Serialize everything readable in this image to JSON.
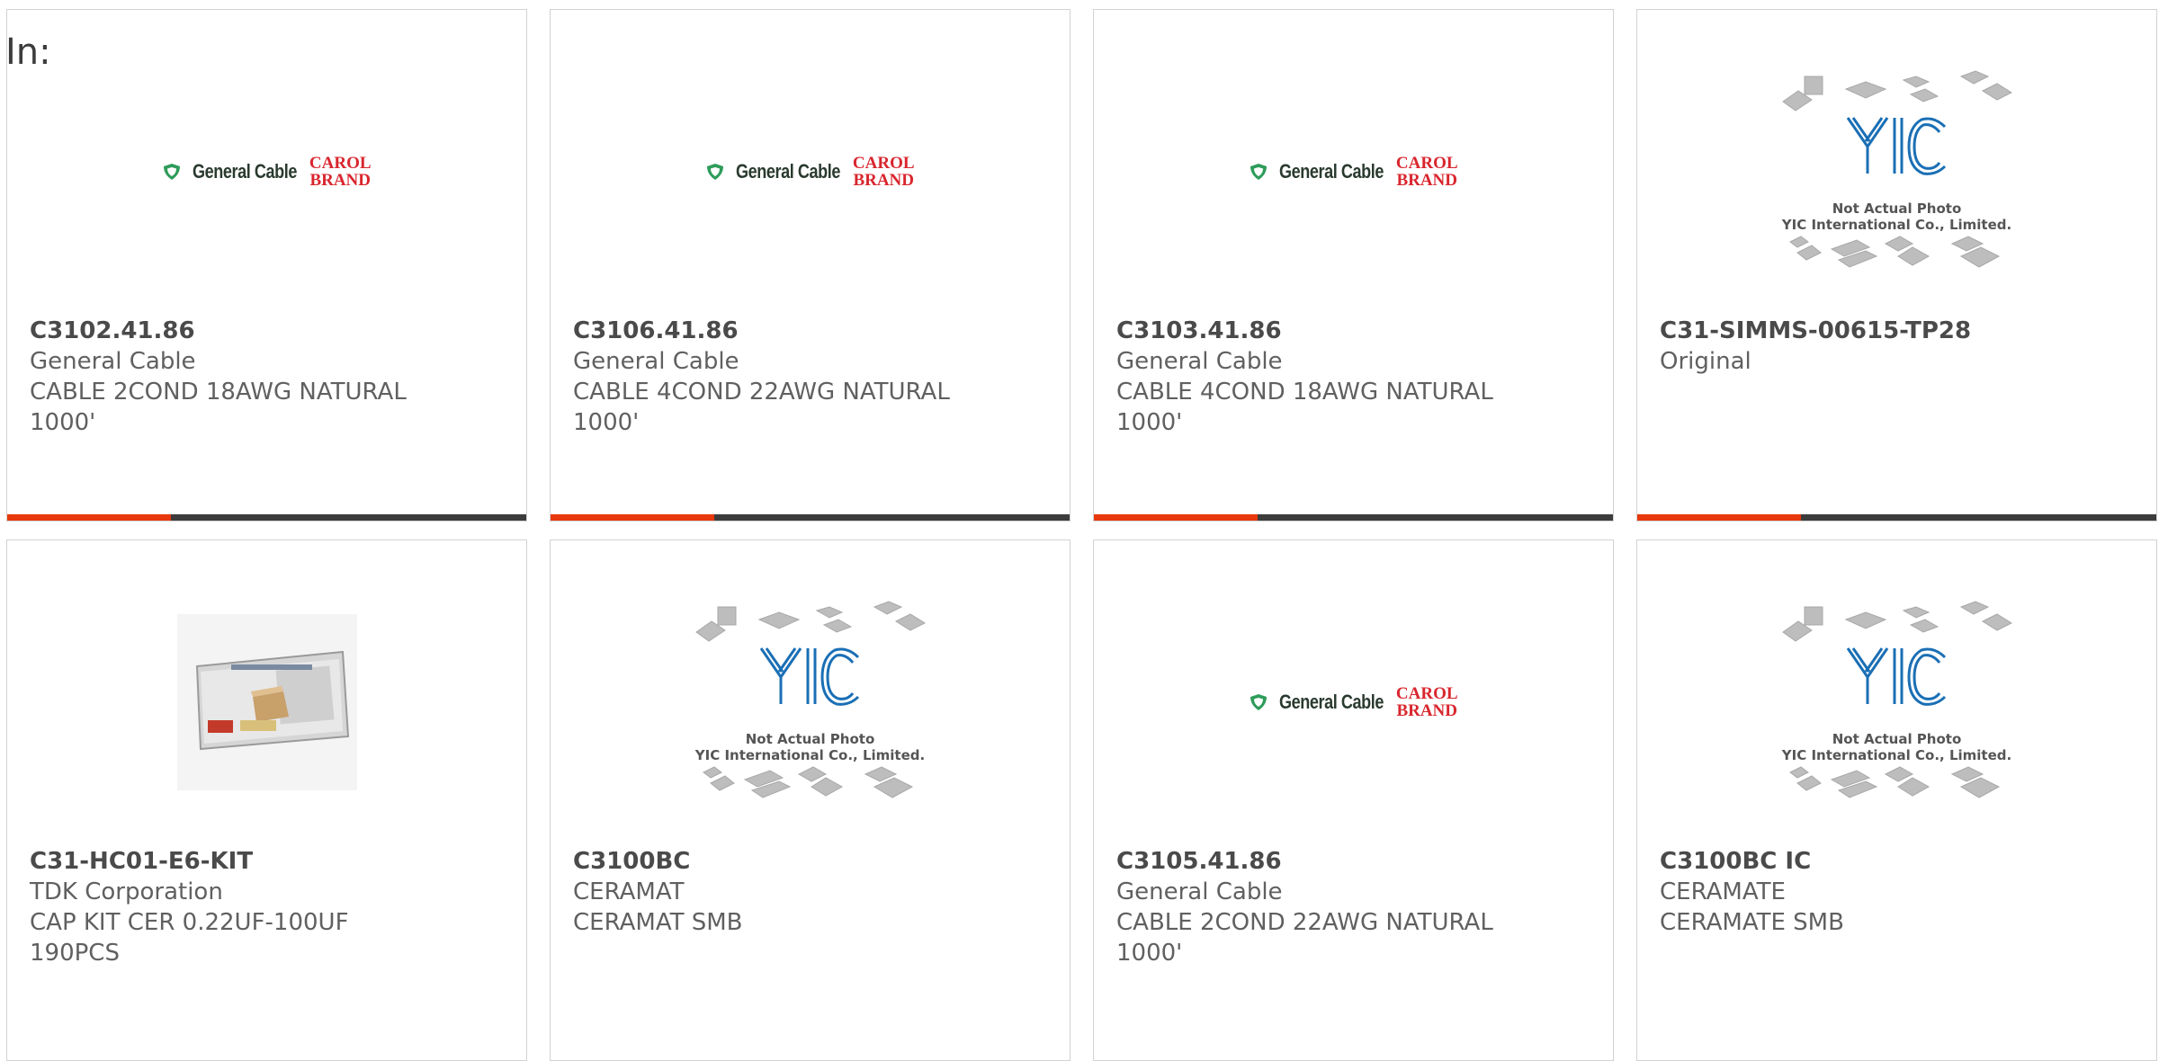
{
  "header": {
    "label": "In:"
  },
  "logos": {
    "general_cable": {
      "name": "General Cable",
      "carol_line1": "CAROL",
      "carol_line2": "BRAND"
    },
    "yic": {
      "caption_line1": "Not Actual Photo",
      "caption_line2": "YIC International Co., Limited."
    }
  },
  "colors": {
    "accent": "#e8380d",
    "bar": "#3c3c3c",
    "border": "#d2d2d2",
    "text": "#606060"
  },
  "products": [
    {
      "part": "C3102.41.86",
      "manufacturer": "General Cable",
      "desc1": "CABLE 2COND 18AWG NATURAL",
      "desc2": "1000'",
      "image": "general-cable-logo"
    },
    {
      "part": "C3106.41.86",
      "manufacturer": "General Cable",
      "desc1": "CABLE 4COND 22AWG NATURAL",
      "desc2": "1000'",
      "image": "general-cable-logo"
    },
    {
      "part": "C3103.41.86",
      "manufacturer": "General Cable",
      "desc1": "CABLE 4COND 18AWG NATURAL",
      "desc2": "1000'",
      "image": "general-cable-logo"
    },
    {
      "part": "C31-SIMMS-00615-TP28",
      "manufacturer": "Original",
      "desc1": "",
      "desc2": "",
      "image": "yic-placeholder"
    },
    {
      "part": "C31-HC01-E6-KIT",
      "manufacturer": "TDK Corporation",
      "desc1": "CAP KIT CER 0.22UF-100UF",
      "desc2": "190PCS",
      "image": "kit-photo"
    },
    {
      "part": "C3100BC",
      "manufacturer": "CERAMAT",
      "desc1": "CERAMAT SMB",
      "desc2": "",
      "image": "yic-placeholder"
    },
    {
      "part": "C3105.41.86",
      "manufacturer": "General Cable",
      "desc1": "CABLE 2COND 22AWG NATURAL",
      "desc2": "1000'",
      "image": "general-cable-logo"
    },
    {
      "part": "C3100BC IC",
      "manufacturer": "CERAMATE",
      "desc1": "CERAMATE SMB",
      "desc2": "",
      "image": "yic-placeholder"
    }
  ]
}
